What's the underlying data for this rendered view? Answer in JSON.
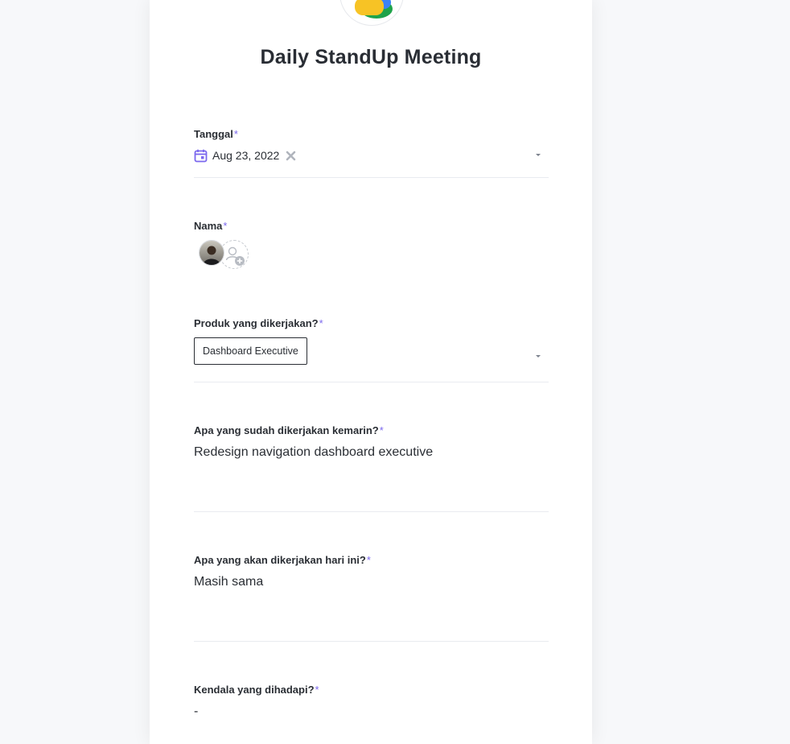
{
  "form": {
    "title": "Daily StandUp Meeting",
    "required_mark": "*",
    "fields": {
      "tanggal": {
        "label": "Tanggal",
        "value": "Aug 23, 2022"
      },
      "nama": {
        "label": "Nama"
      },
      "produk": {
        "label": "Produk yang dikerjakan?",
        "value": "Dashboard Executive"
      },
      "kemarin": {
        "label": "Apa yang sudah dikerjakan kemarin?",
        "value": "Redesign navigation dashboard executive"
      },
      "hari_ini": {
        "label": "Apa yang akan dikerjakan hari ini?",
        "value": "Masih sama"
      },
      "kendala": {
        "label": "Kendala yang dihadapi?",
        "value": "-"
      }
    }
  },
  "icons": {
    "calendar": "calendar-icon",
    "clear": "close-icon",
    "dropdown": "caret-down-icon",
    "add_person": "add-user-icon"
  },
  "colors": {
    "accent": "#7b68ee",
    "text": "#2a2e34",
    "logo_yellow": "#f7c325",
    "logo_green": "#1fa34a",
    "logo_blue": "#3b82f6"
  }
}
